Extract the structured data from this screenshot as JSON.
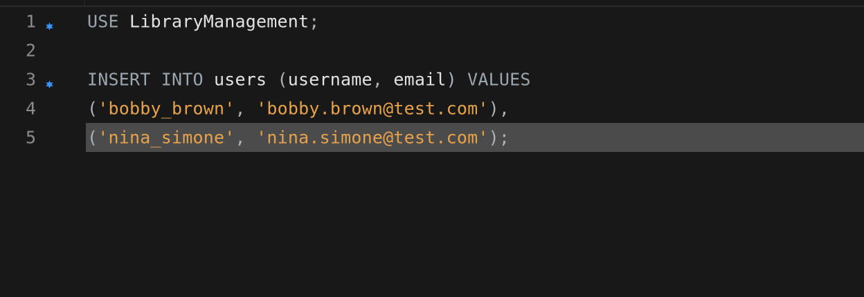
{
  "editor": {
    "lines": [
      {
        "number": "1",
        "run_icon": "run-query-icon",
        "tokens": [
          {
            "text": "USE",
            "kind": "keyword"
          },
          {
            "text": " LibraryManagement",
            "kind": "identifier"
          },
          {
            "text": ";",
            "kind": "punctuation"
          }
        ]
      },
      {
        "number": "2",
        "tokens": []
      },
      {
        "number": "3",
        "run_icon": "run-query-icon",
        "tokens": [
          {
            "text": "INSERT INTO",
            "kind": "keyword"
          },
          {
            "text": " users ",
            "kind": "identifier"
          },
          {
            "text": "(",
            "kind": "punctuation"
          },
          {
            "text": "username",
            "kind": "identifier"
          },
          {
            "text": ", ",
            "kind": "punctuation"
          },
          {
            "text": "email",
            "kind": "identifier"
          },
          {
            "text": ") ",
            "kind": "punctuation"
          },
          {
            "text": "VALUES",
            "kind": "keyword"
          }
        ]
      },
      {
        "number": "4",
        "tokens": [
          {
            "text": "(",
            "kind": "punctuation"
          },
          {
            "text": "'bobby_brown'",
            "kind": "string"
          },
          {
            "text": ", ",
            "kind": "punctuation"
          },
          {
            "text": "'bobby.brown@test.com'",
            "kind": "string"
          },
          {
            "text": "),",
            "kind": "punctuation"
          }
        ]
      },
      {
        "number": "5",
        "selected": true,
        "tokens": [
          {
            "text": "(",
            "kind": "punctuation"
          },
          {
            "text": "'nina_simone'",
            "kind": "string"
          },
          {
            "text": ", ",
            "kind": "punctuation"
          },
          {
            "text": "'nina.simone@test.com'",
            "kind": "string"
          },
          {
            "text": ");",
            "kind": "punctuation"
          }
        ]
      }
    ]
  },
  "colors": {
    "background": "#181818",
    "line_number": "#8b8b8b",
    "keyword": "#9aa5ad",
    "string": "#e7a24a",
    "selection": "#4b4b4b",
    "run_marker": "#3794ff"
  }
}
